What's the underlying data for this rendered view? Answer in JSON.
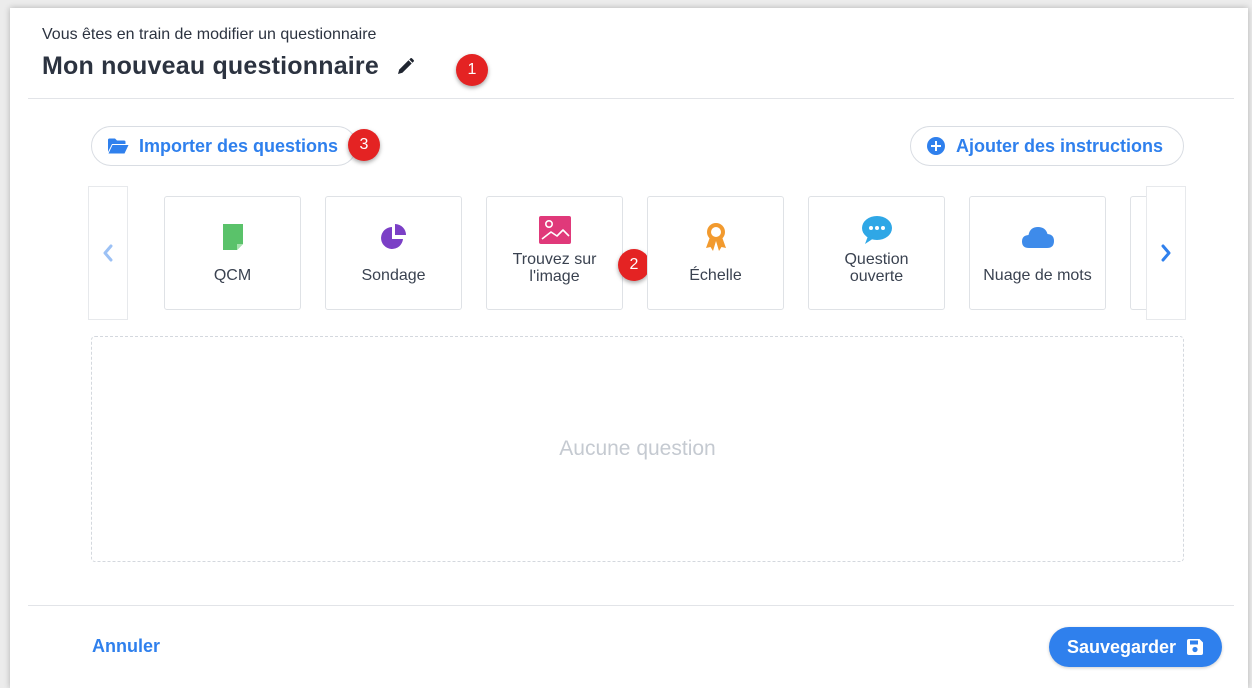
{
  "header": {
    "subtitle": "Vous êtes en train de modifier un questionnaire",
    "title": "Mon nouveau questionnaire",
    "edit_icon": "pencil-icon"
  },
  "callouts": [
    "1",
    "2",
    "3"
  ],
  "toolbar": {
    "import_label": "Importer des questions",
    "import_icon": "folder-open-icon",
    "instructions_label": "Ajouter des instructions",
    "instructions_icon": "plus-circle-icon"
  },
  "question_types": [
    {
      "label": "QCM",
      "icon": "document-icon",
      "color": "#5ac26a"
    },
    {
      "label": "Sondage",
      "icon": "pie-chart-icon",
      "color": "#7b3fc6"
    },
    {
      "label": "Trouvez sur l'image",
      "icon": "image-icon",
      "color": "#e0397a"
    },
    {
      "label": "Échelle",
      "icon": "ribbon-award-icon",
      "color": "#f29a2e"
    },
    {
      "label": "Question ouverte",
      "icon": "speech-bubble-icon",
      "color": "#2fa7e6"
    },
    {
      "label": "Nuage de mots",
      "icon": "cloud-icon",
      "color": "#3e8bea"
    }
  ],
  "carousel": {
    "prev_icon": "chevron-left-icon",
    "next_icon": "chevron-right-icon"
  },
  "dropzone": {
    "empty_text": "Aucune question"
  },
  "footer": {
    "cancel_label": "Annuler",
    "save_label": "Sauvegarder",
    "save_icon": "floppy-disk-icon"
  },
  "colors": {
    "accent": "#2f80ed",
    "callout": "#e42323",
    "text": "#2c3340"
  }
}
